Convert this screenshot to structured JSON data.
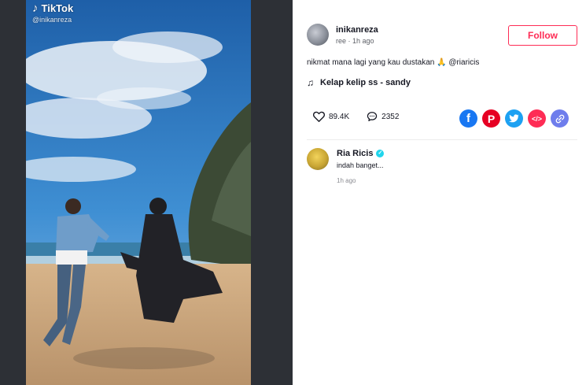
{
  "watermark": {
    "brand": "TikTok",
    "username": "@inikanreza",
    "logo_icon": "tiktok-note-icon"
  },
  "author": {
    "username": "inikanreza",
    "subline": "ree · 1h ago"
  },
  "follow_label": "Follow",
  "caption": {
    "text": "nikmat mana lagi yang kau dustakan 🙏 ",
    "mention": "@riaricis"
  },
  "music": {
    "icon": "music-note-icon",
    "title": "Kelap kelip ss - sandy"
  },
  "stats": {
    "likes": "89.4K",
    "comments": "2352"
  },
  "share_icons": [
    {
      "name": "facebook-icon",
      "color": "#1877f2"
    },
    {
      "name": "pinterest-icon",
      "color": "#e60023"
    },
    {
      "name": "twitter-icon",
      "color": "#1da1f2"
    },
    {
      "name": "embed-icon",
      "color": "#fe2c55"
    },
    {
      "name": "link-icon",
      "color": "#6e7dec"
    }
  ],
  "comment": {
    "author": "Ria Ricis",
    "text": "indah banget...",
    "time": "1h ago"
  },
  "colors": {
    "accent": "#fe2c55",
    "verified": "#20d5ec",
    "backdrop": "#2d3036"
  }
}
